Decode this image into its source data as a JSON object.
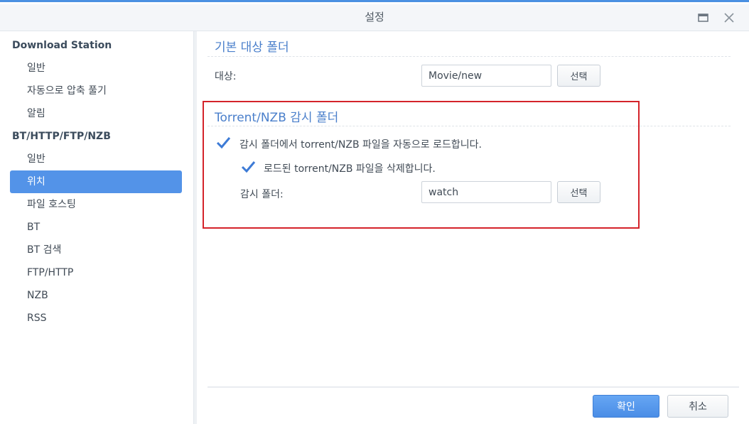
{
  "window": {
    "title": "설정"
  },
  "sidebar": {
    "section1": "Download Station",
    "section1_items": [
      "일반",
      "자동으로 압축 풀기",
      "알림"
    ],
    "section2": "BT/HTTP/FTP/NZB",
    "section2_items": [
      "일반",
      "위치",
      "파일 호스팅",
      "BT",
      "BT 검색",
      "FTP/HTTP",
      "NZB",
      "RSS"
    ],
    "active_item": "위치"
  },
  "default_folder": {
    "title": "기본 대상 폴더",
    "dest_label": "대상:",
    "dest_value": "Movie/new",
    "select_label": "선택"
  },
  "watch_folder": {
    "title": "Torrent/NZB 감시 폴더",
    "auto_load_label": "감시 폴더에서 torrent/NZB 파일을 자동으로 로드합니다.",
    "auto_load_checked": true,
    "delete_label": "로드된 torrent/NZB 파일을 삭제합니다.",
    "delete_checked": true,
    "folder_label": "감시 폴더:",
    "folder_value": "watch",
    "select_label": "선택"
  },
  "footer": {
    "ok_label": "확인",
    "cancel_label": "취소"
  },
  "colors": {
    "accent": "#5393e8",
    "group_title": "#4a7fcb",
    "highlight": "#d4232a",
    "checkmark": "#3d7bd6"
  }
}
